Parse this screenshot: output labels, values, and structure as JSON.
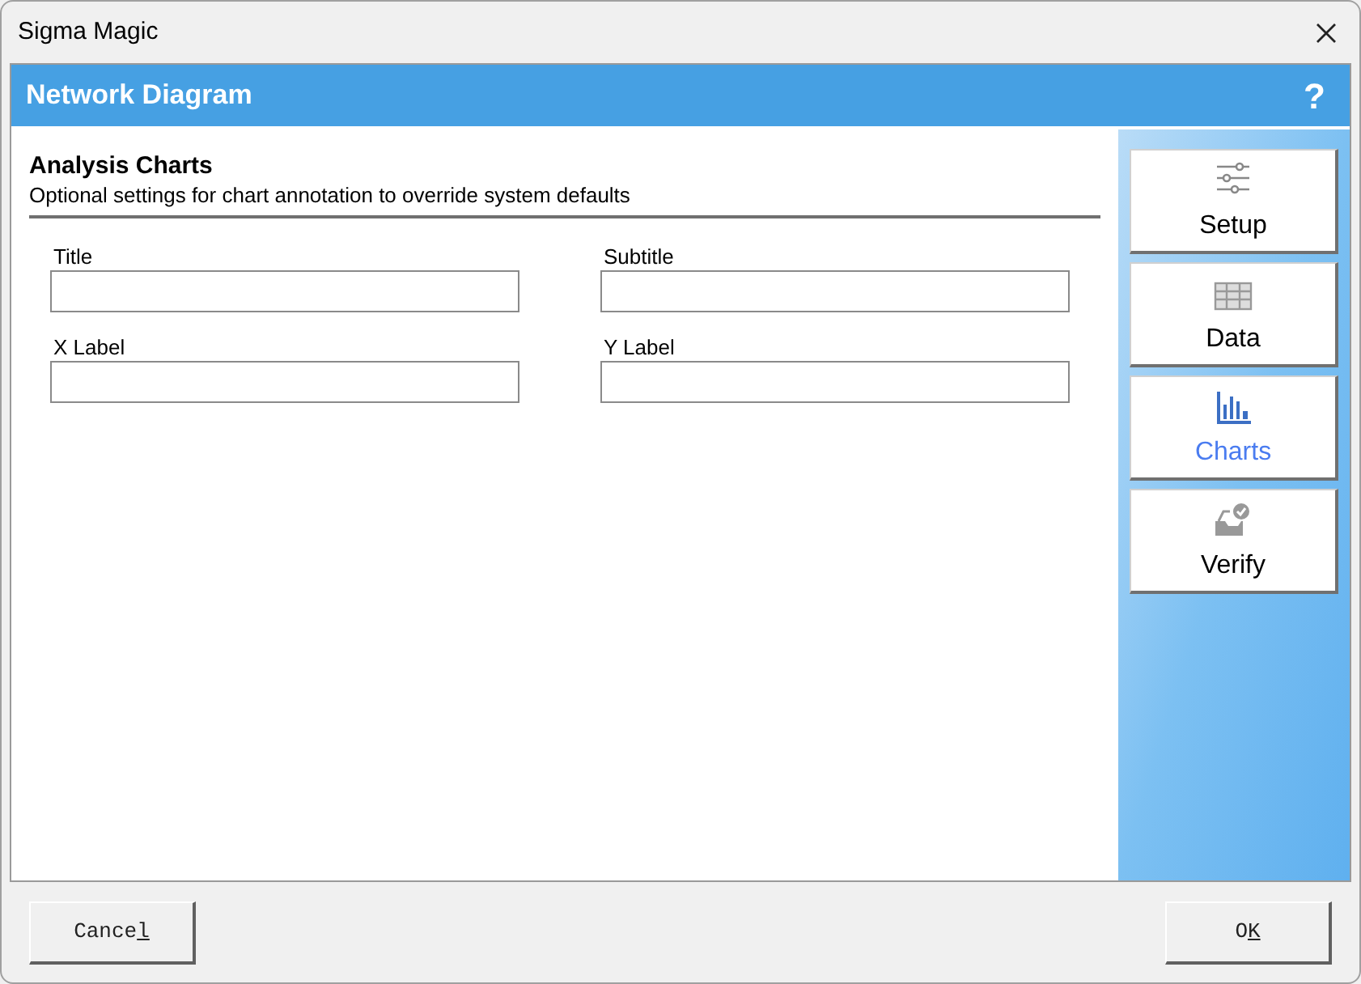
{
  "window": {
    "title": "Sigma Magic"
  },
  "header": {
    "title": "Network Diagram",
    "help": "?"
  },
  "section": {
    "title": "Analysis Charts",
    "description": "Optional settings for chart annotation to override system defaults"
  },
  "fields": [
    {
      "label": "Title"
    },
    {
      "label": "Subtitle"
    },
    {
      "label": "X Label"
    },
    {
      "label": "Y Label"
    }
  ],
  "nav": [
    {
      "kind": "setup",
      "label": "Setup",
      "selected": false
    },
    {
      "kind": "data",
      "label": "Data",
      "selected": false
    },
    {
      "kind": "charts",
      "label": "Charts",
      "selected": true
    },
    {
      "kind": "verify",
      "label": "Verify",
      "selected": false
    }
  ],
  "buttons": [
    {
      "label": "Cance",
      "access_key": "l"
    },
    {
      "label": "O",
      "access_key": "K"
    }
  ]
}
